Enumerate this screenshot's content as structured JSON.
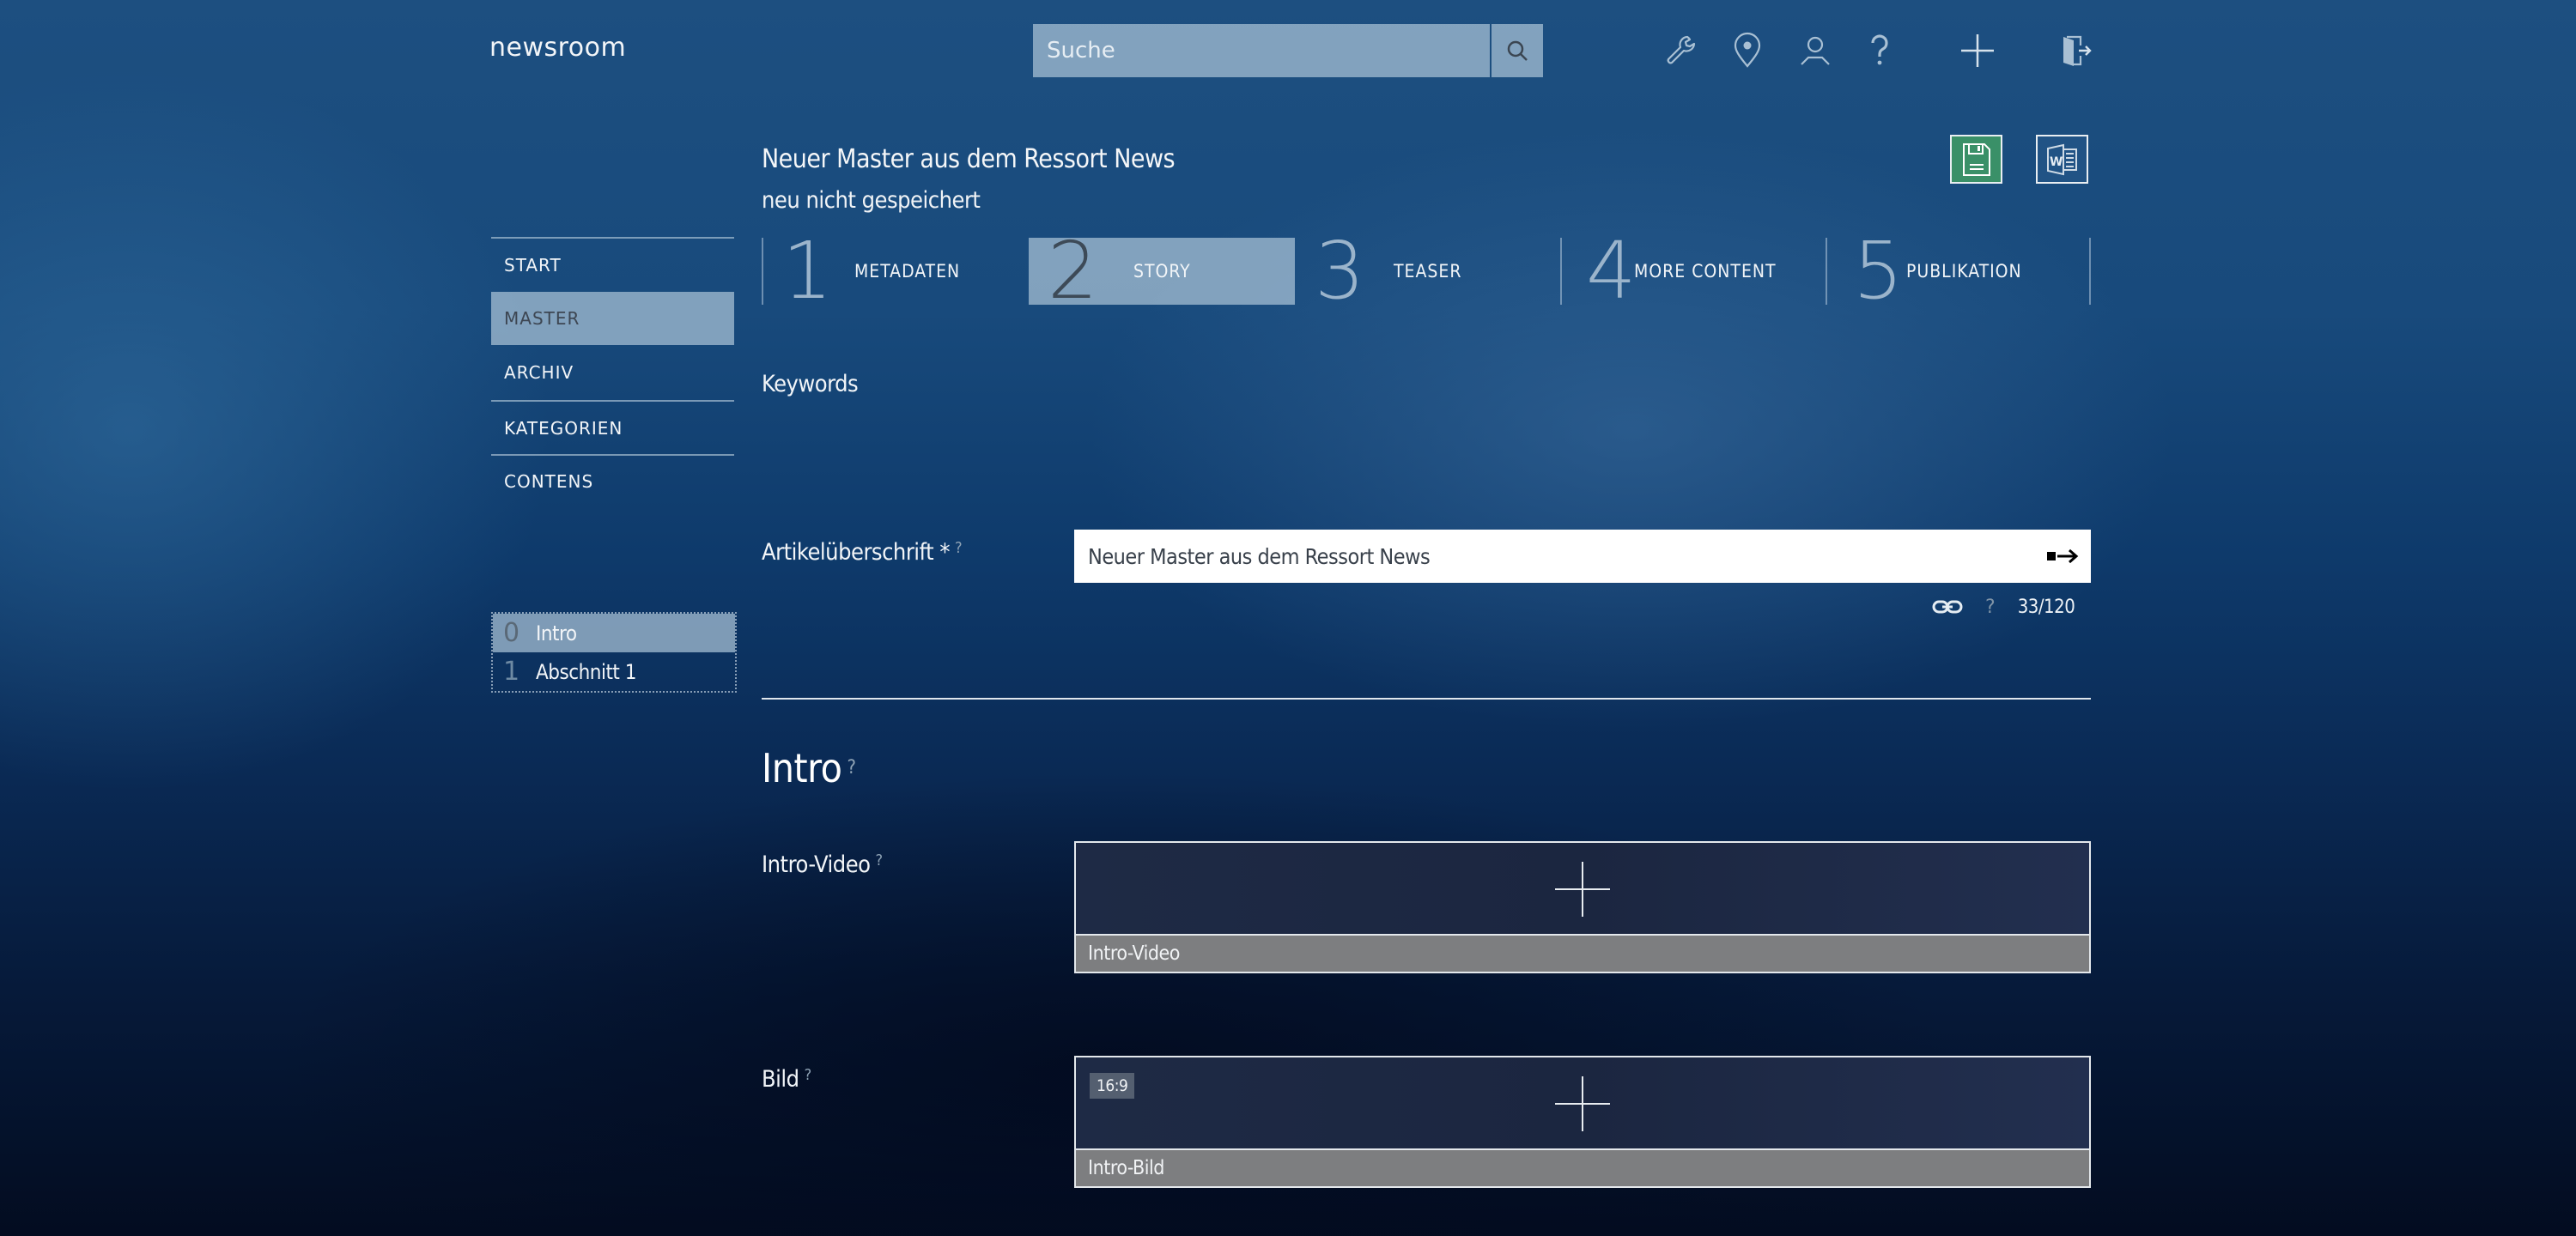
{
  "header": {
    "brand": "newsroom",
    "search": {
      "placeholder": "Suche",
      "value": ""
    },
    "icons": [
      "search-icon",
      "wrench-icon",
      "location-pin-icon",
      "user-icon",
      "help-icon",
      "plus-icon",
      "logout-door-icon"
    ]
  },
  "document": {
    "title": "Neuer Master aus dem Ressort News",
    "status": "neu nicht gespeichert",
    "toolbar": {
      "save_icon": "floppy-disk-icon",
      "word_icon": "word-document-icon",
      "save_color": "#3a9068"
    }
  },
  "sidebar": {
    "items": [
      {
        "label": "START",
        "active": false
      },
      {
        "label": "MASTER",
        "active": true
      },
      {
        "label": "ARCHIV",
        "active": false
      },
      {
        "label": "KATEGORIEN",
        "active": false
      },
      {
        "label": "CONTENS",
        "active": false
      }
    ]
  },
  "steps": [
    {
      "num": "1",
      "label": "METADATEN",
      "active": false
    },
    {
      "num": "2",
      "label": "STORY",
      "active": true
    },
    {
      "num": "3",
      "label": "TEASER",
      "active": false
    },
    {
      "num": "4",
      "label": "MORE CONTENT",
      "active": false
    },
    {
      "num": "5",
      "label": "PUBLIKATION",
      "active": false
    }
  ],
  "sections": [
    {
      "num": "0",
      "label": "Intro",
      "active": true
    },
    {
      "num": "1",
      "label": "Abschnitt 1",
      "active": false
    }
  ],
  "form": {
    "keywords_label": "Keywords",
    "headline_label": "Artikelüberschrift *",
    "help": "?",
    "headline_value": "Neuer Master aus dem Ressort News",
    "headline_count": "33/120",
    "intro_heading": "Intro",
    "video_label": "Intro-Video",
    "video_caption": "Intro-Video",
    "image_label": "Bild",
    "image_caption": "Intro-Bild",
    "image_ratio": "16:9"
  },
  "colors": {
    "active_bg": "#aac3d7",
    "save_green": "#3a9068",
    "caption_gray": "#7d7e80"
  }
}
